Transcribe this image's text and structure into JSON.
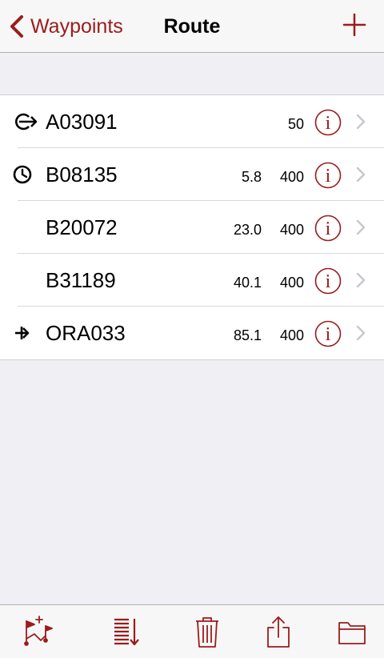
{
  "navbar": {
    "back_label": "Waypoints",
    "title": "Route",
    "back_icon": "chevron-left-icon",
    "add_icon": "plus-icon"
  },
  "colors": {
    "accent": "#9b1c1c",
    "background": "#efeff4",
    "bar": "#f7f7f7"
  },
  "route": {
    "rows": [
      {
        "icon": "departure-icon",
        "name": "A03091",
        "distance": "",
        "altitude": "50"
      },
      {
        "icon": "clock-icon",
        "name": "B08135",
        "distance": "5.8",
        "altitude": "400"
      },
      {
        "icon": "",
        "name": "B20072",
        "distance": "23.0",
        "altitude": "400"
      },
      {
        "icon": "",
        "name": "B31189",
        "distance": "40.1",
        "altitude": "400"
      },
      {
        "icon": "arrival-icon",
        "name": "ORA033",
        "distance": "85.1",
        "altitude": "400"
      }
    ]
  },
  "toolbar": {
    "items": [
      "add-waypoint-flags-icon",
      "sort-icon",
      "trash-icon",
      "share-icon",
      "folder-icon"
    ]
  }
}
